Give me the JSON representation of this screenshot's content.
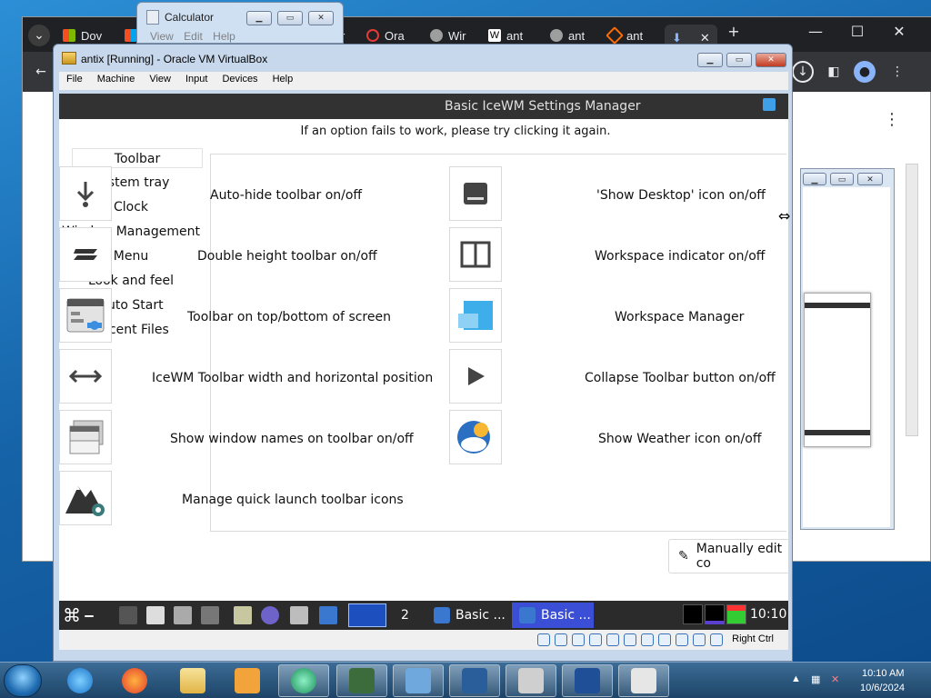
{
  "chrome": {
    "tabs": [
      "Dov",
      "Ora",
      "Wir",
      "ant",
      "ant",
      "ant"
    ],
    "calc_tab_suffix": "r"
  },
  "calculator": {
    "title": "Calculator",
    "menu": [
      "View",
      "Edit",
      "Help"
    ]
  },
  "vbox": {
    "title": "antix [Running] - Oracle VM VirtualBox",
    "menu": [
      "File",
      "Machine",
      "View",
      "Input",
      "Devices",
      "Help"
    ],
    "status_right": "Right Ctrl"
  },
  "icewm": {
    "header_title": "Basic IceWM Settings Manager",
    "hint": "If an option fails to work, please try clicking it again.",
    "sidebar": [
      "Toolbar",
      "System tray",
      "Clock",
      "Window Management",
      "Menu",
      "Look and feel",
      "Auto Start",
      "Recent Files"
    ],
    "left_options": [
      {
        "icon": "download-arrow-icon",
        "label": "Auto-hide toolbar on/off"
      },
      {
        "icon": "double-bar-icon",
        "label": "Double height toolbar on/off"
      },
      {
        "icon": "toolbar-position-icon",
        "label": "Toolbar on top/bottom of screen"
      },
      {
        "icon": "horizontal-arrows-icon",
        "label": "IceWM Toolbar width and horizontal position"
      },
      {
        "icon": "window-names-icon",
        "label": "Show window names on toolbar on/off"
      },
      {
        "icon": "mountain-gear-icon",
        "label": "Manage quick launch toolbar icons"
      }
    ],
    "right_options": [
      {
        "icon": "show-desktop-icon",
        "label": "'Show Desktop' icon on/off"
      },
      {
        "icon": "workspace-indicator-icon",
        "label": "Workspace indicator on/off"
      },
      {
        "icon": "workspace-manager-icon",
        "label": "Workspace Manager"
      },
      {
        "icon": "play-triangle-icon",
        "label": "Collapse Toolbar button on/off"
      },
      {
        "icon": "weather-sun-cloud-icon",
        "label": "Show Weather icon on/off"
      }
    ],
    "edit_button": "Manually edit co",
    "taskbar": {
      "workspace": "2",
      "task1": "Basic ...",
      "task2": "Basic ...",
      "clock": "10:10"
    }
  },
  "windows_taskbar": {
    "time": "10:10 AM",
    "date": "10/6/2024"
  }
}
